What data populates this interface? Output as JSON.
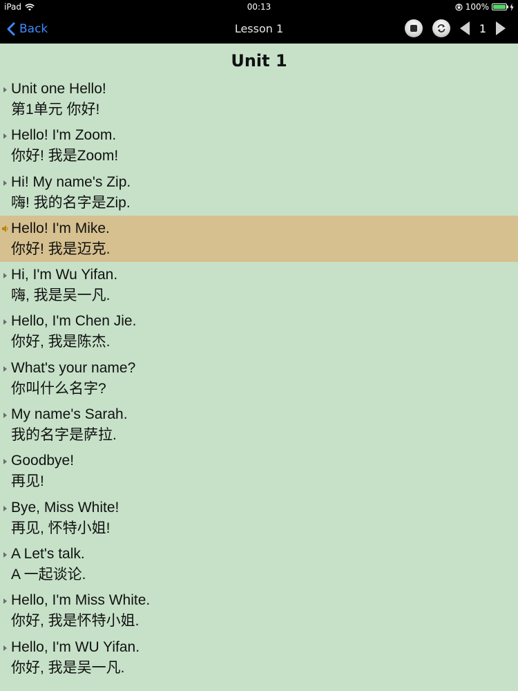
{
  "status_bar": {
    "device": "iPad",
    "time": "00:13",
    "battery": "100%"
  },
  "nav": {
    "back_label": "Back",
    "title": "Lesson 1",
    "page": "1"
  },
  "unit_title": "Unit 1",
  "sentences": [
    {
      "en": "Unit one Hello!",
      "zh": "第1单元 你好!"
    },
    {
      "en": "Hello! I'm Zoom.",
      "zh": "你好! 我是Zoom!"
    },
    {
      "en": "Hi! My name's Zip.",
      "zh": "嗨! 我的名字是Zip."
    },
    {
      "en": "Hello! I'm Mike.",
      "zh": "你好! 我是迈克."
    },
    {
      "en": "Hi, I'm Wu Yifan.",
      "zh": "嗨, 我是吴一凡."
    },
    {
      "en": "Hello, I'm Chen Jie.",
      "zh": "你好, 我是陈杰."
    },
    {
      "en": "What's your name?",
      "zh": "你叫什么名字?"
    },
    {
      "en": "My name's Sarah.",
      "zh": "我的名字是萨拉."
    },
    {
      "en": "Goodbye!",
      "zh": "再见!"
    },
    {
      "en": "Bye, Miss White!",
      "zh": "再见, 怀特小姐!"
    },
    {
      "en": "A Let's talk.",
      "zh": "A 一起谈论."
    },
    {
      "en": "Hello, I'm Miss White.",
      "zh": "你好, 我是怀特小姐."
    },
    {
      "en": "Hello, I'm WU Yifan.",
      "zh": "你好, 我是吴一凡."
    }
  ],
  "colors": {
    "background": "#c6e1c8",
    "highlight": "#d6c08f",
    "back_blue": "#3d8bff"
  },
  "active_index": 3
}
